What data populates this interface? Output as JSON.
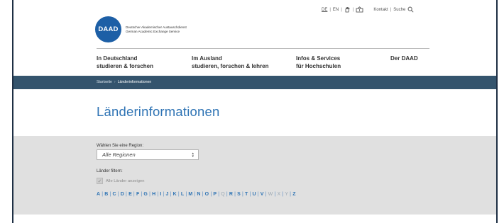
{
  "brand": {
    "logo_text": "DAAD",
    "name_de": "Deutscher Akademischer Austauschdienst",
    "name_en": "German Academic Exchange Service",
    "accent_color": "#1d5fa6"
  },
  "meta_nav": {
    "lang_de": "DE",
    "lang_en": "EN",
    "kontakt": "Kontakt",
    "suche": "Suche",
    "icons": [
      "hand-sign-language-icon",
      "easy-language-icon",
      "search-icon"
    ]
  },
  "main_nav": [
    {
      "line1": "In Deutschland",
      "line2": "studieren & forschen"
    },
    {
      "line1": "Im Ausland",
      "line2": "studieren, forschen & lehren"
    },
    {
      "line1": "Infos & Services",
      "line2": "für Hochschulen"
    },
    {
      "line1": "Der DAAD",
      "line2": ""
    }
  ],
  "breadcrumb": {
    "home": "Startseite",
    "separator": "›",
    "current": "Länderinformationen"
  },
  "page": {
    "title": "Länderinformationen"
  },
  "filters": {
    "region_label": "Wählen Sie eine Region:",
    "region_value": "Alle Regionen",
    "filter_label": "Länder filtern:",
    "show_all_label": "Alle Länder anzeigen",
    "show_all_checked": true
  },
  "alphabet": {
    "letters": [
      "A",
      "B",
      "C",
      "D",
      "E",
      "F",
      "G",
      "H",
      "I",
      "J",
      "K",
      "L",
      "M",
      "N",
      "O",
      "P",
      "Q",
      "R",
      "S",
      "T",
      "U",
      "V",
      "W",
      "X",
      "Y",
      "Z"
    ],
    "inactive": [
      "Q",
      "W",
      "X",
      "Y"
    ]
  },
  "colors": {
    "breadcrumb_bar": "#34546d",
    "title": "#2e73b4",
    "filter_background": "#e0e0e0",
    "frame": "#1e2f44"
  }
}
